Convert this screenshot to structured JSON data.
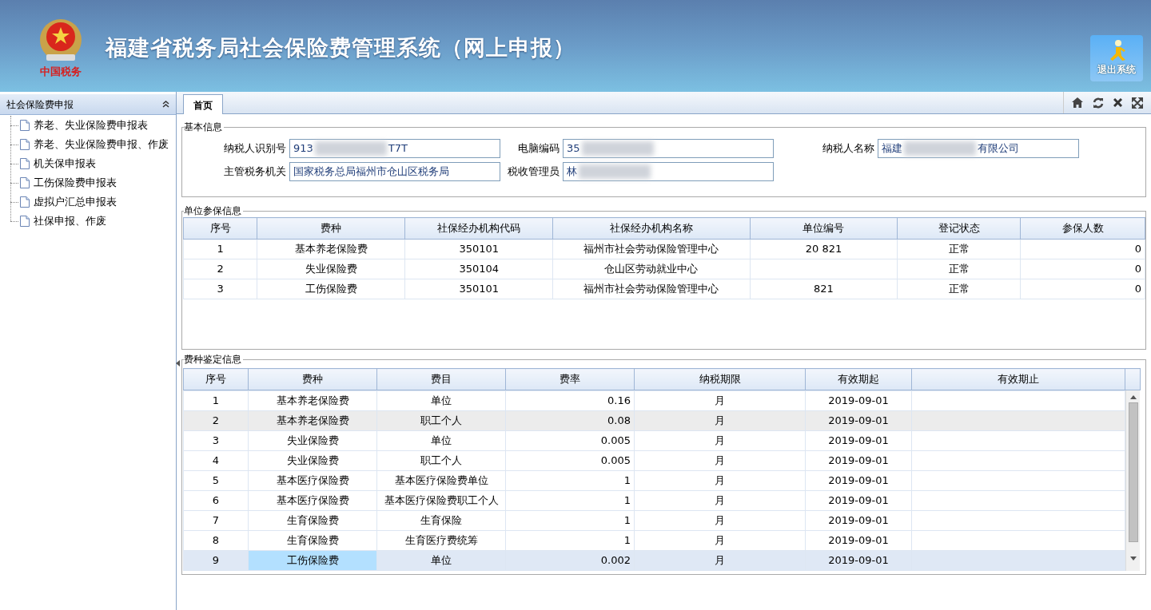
{
  "header": {
    "title": "福建省税务局社会保险费管理系统（网上申报）",
    "logo_caption": "中国税务",
    "exit_button": "退出系统"
  },
  "sidebar": {
    "title": "社会保险费申报",
    "items": [
      {
        "label": "养老、失业保险费申报表"
      },
      {
        "label": "养老、失业保险费申报、作废"
      },
      {
        "label": "机关保申报表"
      },
      {
        "label": "工伤保险费申报表"
      },
      {
        "label": "虚拟户汇总申报表"
      },
      {
        "label": "社保申报、作废"
      }
    ]
  },
  "tabs": [
    {
      "label": "首页",
      "selected": true
    }
  ],
  "basic_info": {
    "legend": "基本信息",
    "fields": [
      {
        "label": "纳税人识别号",
        "value_parts": [
          "913",
          "T7T"
        ],
        "blurred": true
      },
      {
        "label": "电脑编码",
        "value_parts": [
          "35"
        ],
        "blurred": true
      },
      {
        "label": "纳税人名称",
        "value_parts": [
          "福建",
          "有限公司"
        ],
        "blurred": true
      },
      {
        "label": "主管税务机关",
        "value_parts": [
          "国家税务总局福州市仓山区税务局"
        ],
        "blurred": false
      },
      {
        "label": "税收管理员",
        "value_parts": [
          "林"
        ],
        "blurred": true
      }
    ]
  },
  "unit_table": {
    "legend": "单位参保信息",
    "columns": [
      "序号",
      "费种",
      "社保经办机构代码",
      "社保经办机构名称",
      "单位编号",
      "登记状态",
      "参保人数"
    ],
    "rows": [
      [
        "1",
        "基本养老保险费",
        "350101",
        "福州市社会劳动保险管理中心",
        "20 821",
        "正常",
        "0"
      ],
      [
        "2",
        "失业保险费",
        "350104",
        "仓山区劳动就业中心",
        "",
        "正常",
        "0"
      ],
      [
        "3",
        "工伤保险费",
        "350101",
        "福州市社会劳动保险管理中心",
        "821",
        "正常",
        "0"
      ]
    ]
  },
  "fee_table": {
    "legend": "费种鉴定信息",
    "columns": [
      "序号",
      "费种",
      "费目",
      "费率",
      "纳税期限",
      "有效期起",
      "有效期止"
    ],
    "rows": [
      {
        "cells": [
          "1",
          "基本养老保险费",
          "单位",
          "0.16",
          "月",
          "2019-09-01",
          ""
        ],
        "highlighted": false,
        "selected": false
      },
      {
        "cells": [
          "2",
          "基本养老保险费",
          "职工个人",
          "0.08",
          "月",
          "2019-09-01",
          ""
        ],
        "highlighted": true,
        "selected": false
      },
      {
        "cells": [
          "3",
          "失业保险费",
          "单位",
          "0.005",
          "月",
          "2019-09-01",
          ""
        ],
        "highlighted": false,
        "selected": false
      },
      {
        "cells": [
          "4",
          "失业保险费",
          "职工个人",
          "0.005",
          "月",
          "2019-09-01",
          ""
        ],
        "highlighted": false,
        "selected": false
      },
      {
        "cells": [
          "5",
          "基本医疗保险费",
          "基本医疗保险费单位",
          "1",
          "月",
          "2019-09-01",
          ""
        ],
        "highlighted": false,
        "selected": false
      },
      {
        "cells": [
          "6",
          "基本医疗保险费",
          "基本医疗保险费职工个人",
          "1",
          "月",
          "2019-09-01",
          ""
        ],
        "highlighted": false,
        "selected": false
      },
      {
        "cells": [
          "7",
          "生育保险费",
          "生育保险",
          "1",
          "月",
          "2019-09-01",
          ""
        ],
        "highlighted": false,
        "selected": false
      },
      {
        "cells": [
          "8",
          "生育保险费",
          "生育医疗费统筹",
          "1",
          "月",
          "2019-09-01",
          ""
        ],
        "highlighted": false,
        "selected": false
      },
      {
        "cells": [
          "9",
          "工伤保险费",
          "单位",
          "0.002",
          "月",
          "2019-09-01",
          ""
        ],
        "highlighted": false,
        "selected": true
      }
    ]
  }
}
